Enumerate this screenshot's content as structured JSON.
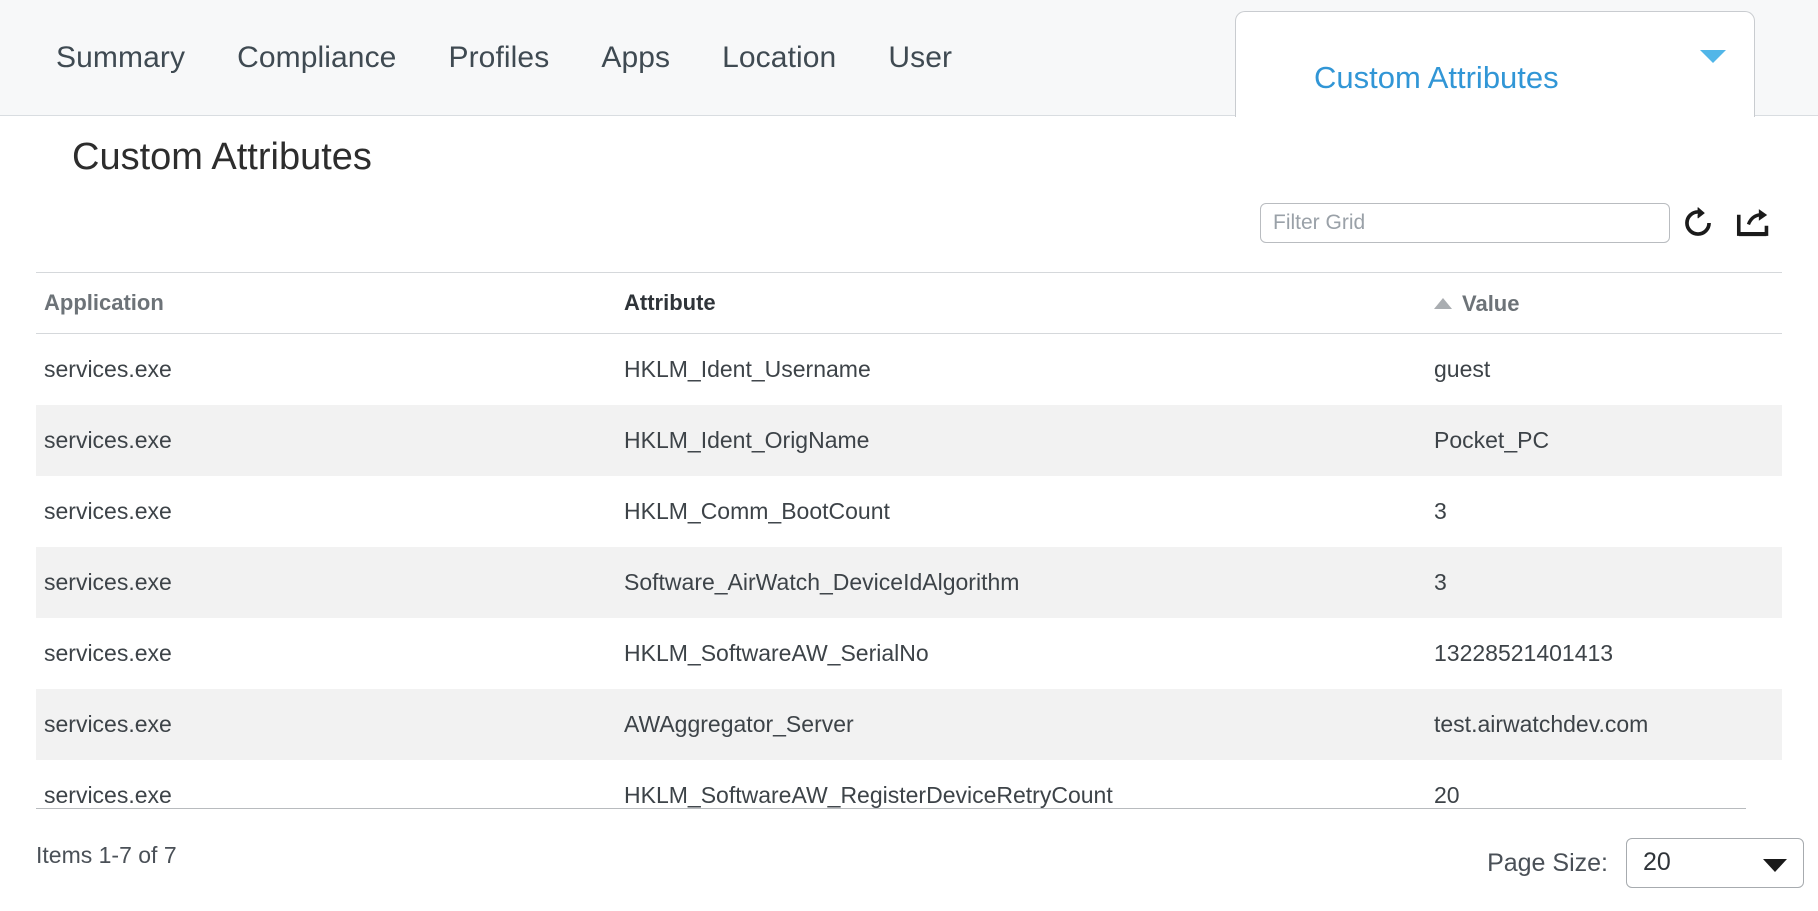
{
  "tabs": {
    "items": [
      {
        "label": "Summary"
      },
      {
        "label": "Compliance"
      },
      {
        "label": "Profiles"
      },
      {
        "label": "Apps"
      },
      {
        "label": "Location"
      },
      {
        "label": "User"
      }
    ],
    "active": {
      "label": "Custom Attributes",
      "caret_icon": "chevron-down-icon"
    },
    "active_color": "#3196d6"
  },
  "page": {
    "title": "Custom Attributes"
  },
  "toolbar": {
    "filter_placeholder": "Filter Grid",
    "filter_value": "",
    "refresh_icon": "refresh-icon",
    "export_icon": "export-icon"
  },
  "grid": {
    "columns": [
      {
        "key": "application",
        "label": "Application",
        "sorted": false
      },
      {
        "key": "attribute",
        "label": "Attribute",
        "sorted": true,
        "sort_dir": "asc",
        "sort_icon": "sort-ascending-icon"
      },
      {
        "key": "value",
        "label": "Value",
        "sorted": false
      }
    ],
    "rows": [
      {
        "application": "services.exe",
        "attribute": "HKLM_Ident_Username",
        "value": "guest"
      },
      {
        "application": "services.exe",
        "attribute": "HKLM_Ident_OrigName",
        "value": "Pocket_PC"
      },
      {
        "application": "services.exe",
        "attribute": "HKLM_Comm_BootCount",
        "value": "3"
      },
      {
        "application": "services.exe",
        "attribute": "Software_AirWatch_DeviceIdAlgorithm",
        "value": "3"
      },
      {
        "application": "services.exe",
        "attribute": "HKLM_SoftwareAW_SerialNo",
        "value": "13228521401413"
      },
      {
        "application": "services.exe",
        "attribute": "AWAggregator_Server",
        "value": "test.airwatchdev.com"
      },
      {
        "application": "services.exe",
        "attribute": "HKLM_SoftwareAW_RegisterDeviceRetryCount",
        "value": "20"
      }
    ]
  },
  "footer": {
    "items_count": "Items 1-7 of 7",
    "page_size_label": "Page Size:",
    "page_size_value": "20",
    "page_size_options": [
      "20"
    ]
  }
}
